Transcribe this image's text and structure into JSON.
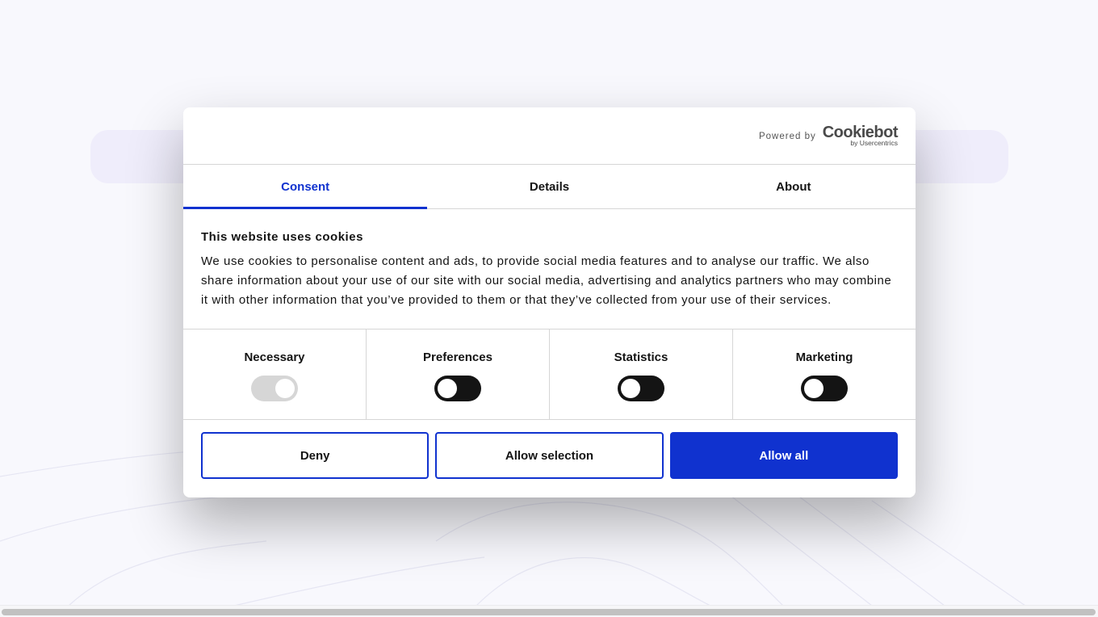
{
  "branding": {
    "powered_by": "Powered by",
    "logo_word": "Cookiebot",
    "logo_sub": "by Usercentrics"
  },
  "tabs": [
    {
      "label": "Consent",
      "active": true
    },
    {
      "label": "Details",
      "active": false
    },
    {
      "label": "About",
      "active": false
    }
  ],
  "content": {
    "title": "This website uses cookies",
    "description": "We use cookies to personalise content and ads, to provide social media features and to analyse our traffic. We also share information about your use of our site with our social media, advertising and analytics partners who may combine it with other information that you’ve provided to them or that they’ve collected from your use of their services."
  },
  "categories": [
    {
      "label": "Necessary",
      "checked": true,
      "disabled": true
    },
    {
      "label": "Preferences",
      "checked": false,
      "disabled": false
    },
    {
      "label": "Statistics",
      "checked": false,
      "disabled": false
    },
    {
      "label": "Marketing",
      "checked": false,
      "disabled": false
    }
  ],
  "buttons": {
    "deny": "Deny",
    "allow_selection": "Allow selection",
    "allow_all": "Allow all"
  },
  "colors": {
    "accent": "#1032cf",
    "toggle_off": "#141414",
    "toggle_disabled": "#d6d6d6"
  }
}
